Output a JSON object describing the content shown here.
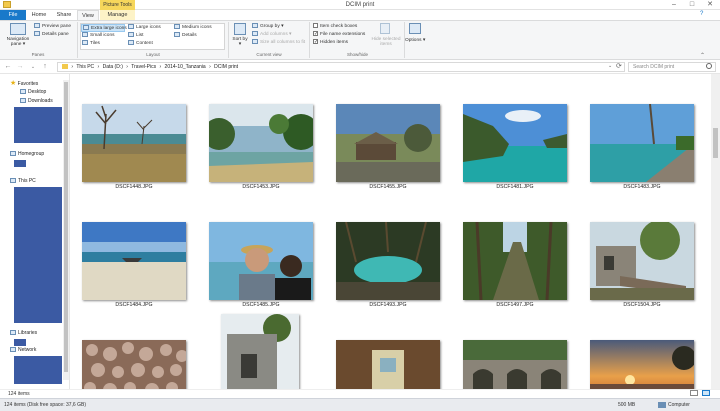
{
  "window": {
    "title": "DCIM print",
    "context_tab": "Picture Tools",
    "min_glyph": "–",
    "max_glyph": "□",
    "close_glyph": "✕"
  },
  "tabs": {
    "file": "File",
    "home": "Home",
    "share": "Share",
    "view": "View",
    "manage": "Manage"
  },
  "ribbon": {
    "panes": {
      "navigation_pane": "Navigation pane ▾",
      "preview_pane": "Preview pane",
      "details_pane": "Details pane",
      "group_label": "Panes"
    },
    "layout": {
      "items": [
        "Extra large icons",
        "Large icons",
        "Medium icons",
        "Small icons",
        "List",
        "Details",
        "Tiles",
        "Content"
      ],
      "group_label": "Layout"
    },
    "current_view": {
      "sort_by": "Sort by ▾",
      "group_by": "Group by ▾",
      "add_columns": "Add columns ▾",
      "size_columns": "Size all columns to fit",
      "group_label": "Current view"
    },
    "show_hide": {
      "item_check_boxes": "Item check boxes",
      "file_name_extensions": "File name extensions",
      "hidden_items": "Hidden items",
      "hide_selected": "Hide selected items",
      "group_label": "Show/hide"
    },
    "options": "Options ▾"
  },
  "address": {
    "back": "←",
    "forward": "→",
    "up": "↑",
    "dropdown": "⌄",
    "refresh": "⟳",
    "crumbs": [
      "This PC",
      "Data (D:)",
      "Travel-Pics",
      "2014-10_Tanzania",
      "DCIM print"
    ],
    "separator": "›",
    "search_placeholder": "Search DCIM print",
    "search_icon": "search-icon"
  },
  "nav": {
    "favorites": "Favorites",
    "desktop": "Desktop",
    "downloads": "Downloads",
    "homegroup": "Homegroup",
    "this_pc": "This PC",
    "libraries": "Libraries",
    "network": "Network"
  },
  "files": [
    "DSCF1448.JPG",
    "DSCF1453.JPG",
    "DSCF1455.JPG",
    "DSCF1481.JPG",
    "DSCF1483.JPG",
    "DSCF1484.JPG",
    "DSCF1485.JPG",
    "DSCF1493.JPG",
    "DSCF1497.JPG",
    "DSCF1504.JPG",
    "",
    "",
    "",
    "",
    ""
  ],
  "status": {
    "item_count": "124 items",
    "free_space": "124 items (Disk free space: 37,6 GB)",
    "size": "500 MB",
    "location": "Computer"
  },
  "colors": {
    "accent": "#1979ca",
    "picture_tools": "#f6d65b",
    "nav_placeholder": "#3b5aa3",
    "selected_layout": "#cce4f7"
  }
}
